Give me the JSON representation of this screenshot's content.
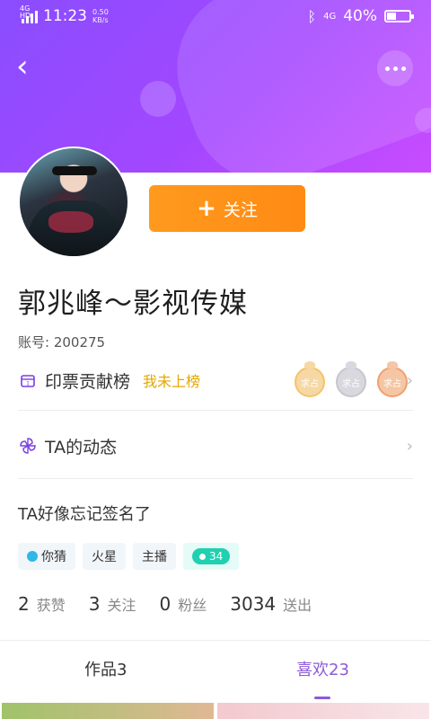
{
  "status_bar": {
    "network": "4G HD",
    "time": "11:23",
    "speed_value": "0.50",
    "speed_unit": "KB/s",
    "network_right": "4G",
    "battery_percent": "40%",
    "battery_level": 0.4
  },
  "profile": {
    "name": "郭兆峰～影视传媒",
    "account": "账号: 200275",
    "follow_label": "关注",
    "signature": "TA好像忘记签名了"
  },
  "rows": {
    "ticket_rank_label": "印票贡献榜",
    "ticket_rank_status": "我未上榜",
    "feed_label": "TA的动态"
  },
  "medals": [
    "求占",
    "求占",
    "求占"
  ],
  "tags": {
    "guess": "你猜",
    "mars": "火星",
    "anchor": "主播",
    "level": "34"
  },
  "stats": [
    {
      "num": "2",
      "label": "获赞"
    },
    {
      "num": "3",
      "label": "关注"
    },
    {
      "num": "0",
      "label": "粉丝"
    },
    {
      "num": "3034",
      "label": "送出"
    }
  ],
  "tabs": {
    "works": "作品3",
    "likes": "喜欢23"
  }
}
